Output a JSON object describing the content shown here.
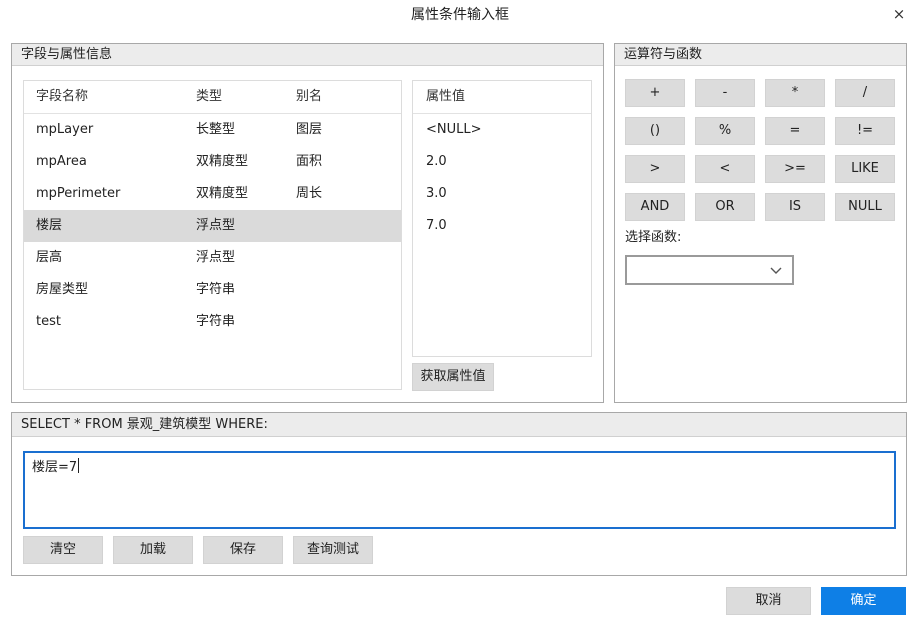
{
  "dialog": {
    "title": "属性条件输入框",
    "close_symbol": "×"
  },
  "fields_panel": {
    "title": "字段与属性信息",
    "columns": {
      "name": "字段名称",
      "type": "类型",
      "alias": "别名"
    },
    "rows": [
      {
        "name": "mpLayer",
        "type": "长整型",
        "alias": "图层"
      },
      {
        "name": "mpArea",
        "type": "双精度型",
        "alias": "面积"
      },
      {
        "name": "mpPerimeter",
        "type": "双精度型",
        "alias": "周长"
      },
      {
        "name": "楼层",
        "type": "浮点型",
        "alias": ""
      },
      {
        "name": "层高",
        "type": "浮点型",
        "alias": ""
      },
      {
        "name": "房屋类型",
        "type": "字符串",
        "alias": ""
      },
      {
        "name": "test",
        "type": "字符串",
        "alias": ""
      }
    ],
    "selected_row": 3,
    "values_header": "属性值",
    "values": [
      "<NULL>",
      "2.0",
      "3.0",
      "7.0"
    ],
    "get_values_button": "获取属性值"
  },
  "operators_panel": {
    "title": "运算符与函数",
    "operators": [
      "+",
      "-",
      "*",
      "/",
      "()",
      "%",
      "=",
      "!=",
      ">",
      "<",
      ">=",
      "LIKE",
      "AND",
      "OR",
      "IS",
      "NULL"
    ],
    "function_label": "选择函数:",
    "function_value": ""
  },
  "sql_panel": {
    "title": "SELECT * FROM 景观_建筑模型 WHERE:",
    "expression": "楼层=7",
    "buttons": {
      "clear": "清空",
      "load": "加载",
      "save": "保存",
      "test": "查询测试"
    }
  },
  "footer": {
    "cancel": "取消",
    "ok": "确定"
  }
}
